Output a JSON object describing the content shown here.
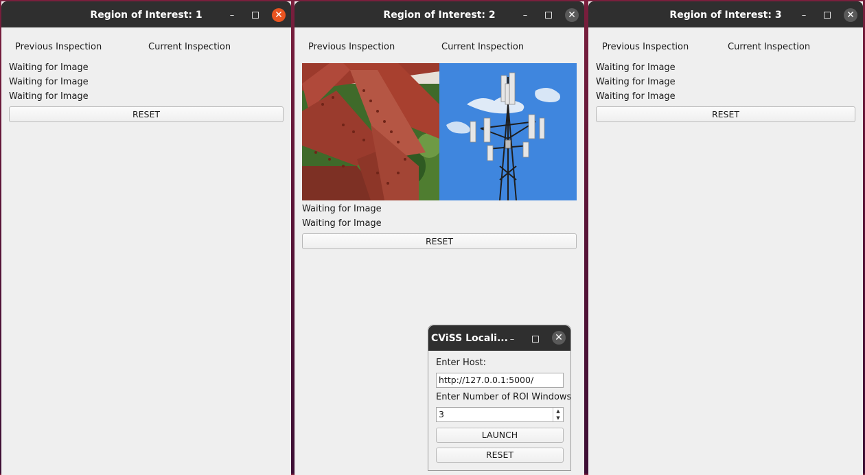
{
  "windows": [
    {
      "title": "Region of Interest: 1",
      "previous_label": "Previous Inspection",
      "current_label": "Current Inspection",
      "status_lines": [
        "Waiting for Image",
        "Waiting for Image",
        "Waiting for Image"
      ],
      "reset_label": "RESET"
    },
    {
      "title": "Region of Interest: 2",
      "previous_label": "Previous Inspection",
      "current_label": "Current Inspection",
      "status_lines": [
        "Waiting for Image",
        "Waiting for Image"
      ],
      "reset_label": "RESET"
    },
    {
      "title": "Region of Interest: 3",
      "previous_label": "Previous Inspection",
      "current_label": "Current Inspection",
      "status_lines": [
        "Waiting for Image",
        "Waiting for Image",
        "Waiting for Image"
      ],
      "reset_label": "RESET"
    }
  ],
  "launcher": {
    "title": "CViSS Locali...",
    "host_label": "Enter Host:",
    "host_value": "http://127.0.0.1:5000/",
    "roi_label": "Enter Number of ROI Windows.",
    "roi_value": "3",
    "launch_label": "LAUNCH",
    "reset_label": "RESET"
  },
  "icons": {
    "minimize": "minimize-icon",
    "maximize": "maximize-icon",
    "close": "close-icon",
    "spin_up": "chevron-up-icon",
    "spin_down": "chevron-down-icon"
  },
  "colors": {
    "titlebar": "#2f2f2f",
    "active_close": "#e95420",
    "window_bg": "#efefef",
    "desktop": "#5a1437"
  }
}
